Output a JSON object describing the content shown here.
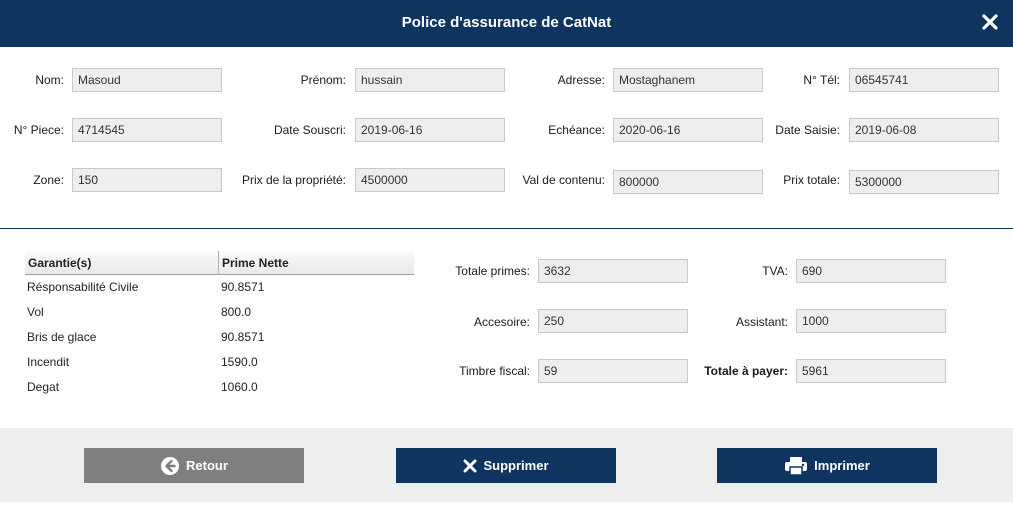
{
  "window": {
    "title": "Police d'assurance de CatNat",
    "close_icon": "close-icon"
  },
  "colors": {
    "primary": "#0f3460",
    "retour_button": "#7f7f7f",
    "field_bg": "#eeeeee"
  },
  "form": {
    "nom": {
      "label": "Nom:",
      "value": "Masoud"
    },
    "prenom": {
      "label": "Prénom:",
      "value": "hussain"
    },
    "adresse": {
      "label": "Adresse:",
      "value": "Mostaghanem"
    },
    "tel": {
      "label": "N° Tél:",
      "value": "06545741"
    },
    "piece": {
      "label": "N° Piece:",
      "value": "4714545"
    },
    "date_souscri": {
      "label": "Date Souscri:",
      "value": "2019-06-16"
    },
    "echeance": {
      "label": "Echéance:",
      "value": "2020-06-16"
    },
    "date_saisie": {
      "label": "Date Saisie:",
      "value": "2019-06-08"
    },
    "zone": {
      "label": "Zone:",
      "value": "150"
    },
    "prix_propriete": {
      "label": "Prix de la propriété:",
      "value": "4500000"
    },
    "val_contenu": {
      "label": "Val de contenu:",
      "value": "800000"
    },
    "prix_totale": {
      "label": "Prix totale:",
      "value": "5300000"
    }
  },
  "garanties": {
    "columns": [
      "Garantie(s)",
      "Prime Nette"
    ],
    "rows": [
      {
        "name": "Résponsabilité Civile",
        "prime": "90.8571"
      },
      {
        "name": "Vol",
        "prime": "800.0"
      },
      {
        "name": "Bris de glace",
        "prime": "90.8571"
      },
      {
        "name": "Incendit",
        "prime": "1590.0"
      },
      {
        "name": "Degat",
        "prime": "1060.0"
      }
    ]
  },
  "totals": {
    "totale_primes": {
      "label": "Totale primes:",
      "value": "3632"
    },
    "tva": {
      "label": "TVA:",
      "value": "690"
    },
    "accesoire": {
      "label": "Accesoire:",
      "value": "250"
    },
    "assistant": {
      "label": "Assistant:",
      "value": "1000"
    },
    "timbre": {
      "label": "Timbre fiscal:",
      "value": "59"
    },
    "totale_payer": {
      "label": "Totale à payer:",
      "value": "5961"
    }
  },
  "actions": {
    "retour": {
      "label": "Retour",
      "icon": "arrow-left-circle-icon"
    },
    "supprimer": {
      "label": "Supprimer",
      "icon": "close-icon"
    },
    "imprimer": {
      "label": "Imprimer",
      "icon": "printer-icon"
    }
  }
}
